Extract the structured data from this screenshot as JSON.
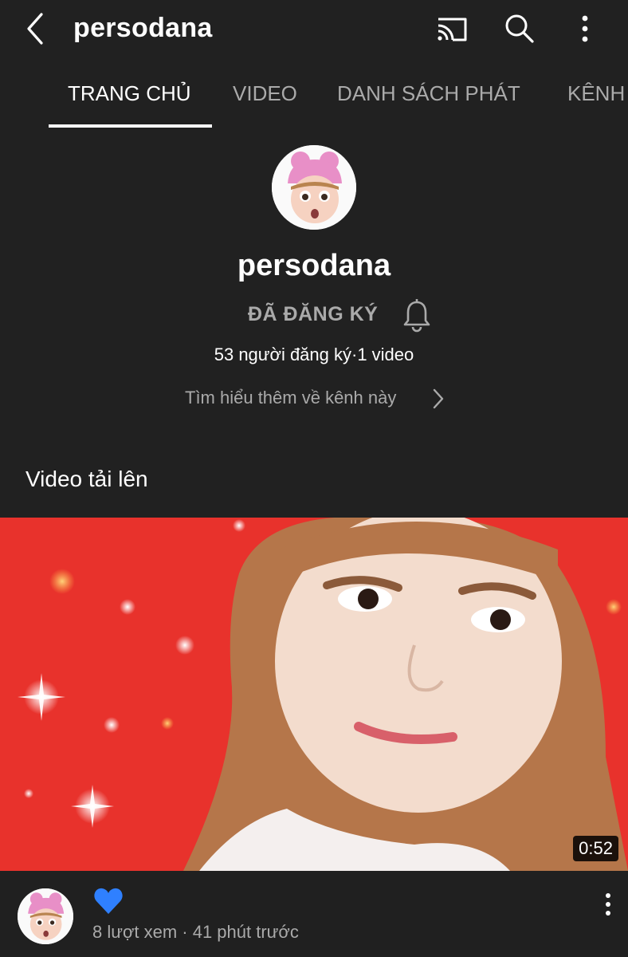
{
  "app": {
    "channel_title": "persodana"
  },
  "topbar": {
    "icons": [
      "back-chevron-icon",
      "cast-icon",
      "search-icon",
      "more-vert-icon"
    ]
  },
  "tabs": [
    {
      "label": "TRANG CHỦ",
      "active": true
    },
    {
      "label": "VIDEO",
      "active": false
    },
    {
      "label": "DANH SÁCH PHÁT",
      "active": false
    },
    {
      "label": "KÊNH",
      "active": false
    }
  ],
  "profile": {
    "name": "persodana",
    "subscribe_label": "ĐÃ ĐĂNG KÝ",
    "stats": "53 người đăng ký·1 video",
    "learn_more": "Tìm hiểu thêm về kênh này"
  },
  "uploads": {
    "section_title": "Video tải lên",
    "video": {
      "title": "💙",
      "duration": "0:52",
      "meta": "8 lượt xem · 41 phút trước"
    }
  },
  "colors": {
    "background": "#212121",
    "muted_text": "#aaaaaa",
    "thumbnail_bg": "#e8322c",
    "heart": "#2f80ff"
  }
}
